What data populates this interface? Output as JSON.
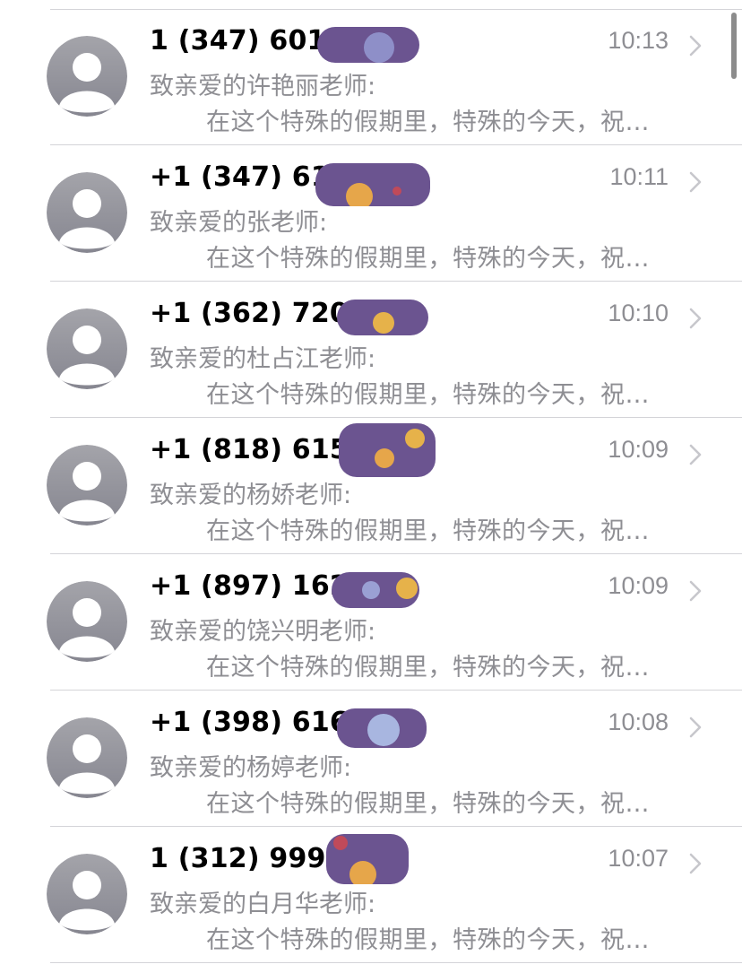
{
  "messages": [
    {
      "sender": "1 (347) 601",
      "time": "10:13",
      "preview_line1": "致亲爱的许艳丽老师:",
      "preview_line2": "在这个特殊的假期里，特殊的今天，祝…"
    },
    {
      "sender": "+1 (347) 612",
      "time": "10:11",
      "preview_line1": "致亲爱的张老师:",
      "preview_line2": "在这个特殊的假期里，特殊的今天，祝…"
    },
    {
      "sender": "+1 (362) 720-",
      "time": "10:10",
      "preview_line1": "致亲爱的杜占江老师:",
      "preview_line2": "在这个特殊的假期里，特殊的今天，祝…"
    },
    {
      "sender": "+1 (818) 615-",
      "time": "10:09",
      "preview_line1": "致亲爱的杨娇老师:",
      "preview_line2": "在这个特殊的假期里，特殊的今天，祝…"
    },
    {
      "sender": "+1 (897) 162",
      "time": "10:09",
      "preview_line1": "致亲爱的饶兴明老师:",
      "preview_line2": "在这个特殊的假期里，特殊的今天，祝…"
    },
    {
      "sender": "+1 (398) 616-",
      "time": "10:08",
      "preview_line1": "致亲爱的杨婷老师:",
      "preview_line2": "在这个特殊的假期里，特殊的今天，祝…"
    },
    {
      "sender": "1 (312) 999-",
      "time": "10:07",
      "preview_line1": "致亲爱的白月华老师:",
      "preview_line2": "在这个特殊的假期里，特殊的今天，祝…"
    }
  ],
  "icons": {
    "avatar": "person-silhouette-icon",
    "disclosure": "chevron-right-icon"
  },
  "colors": {
    "text_primary": "#000000",
    "text_secondary": "#8e8e93",
    "divider": "#d4d4d8",
    "avatar_gradient_top": "#a4a4aa",
    "avatar_gradient_bottom": "#868690",
    "redaction": "#6b5490"
  }
}
